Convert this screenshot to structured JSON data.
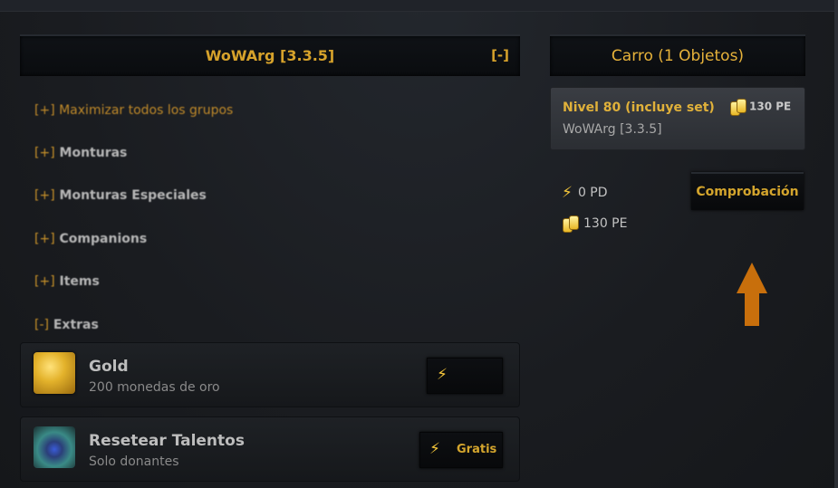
{
  "store": {
    "title": "WoWArg [3.3.5]",
    "collapse_label": "[-]",
    "maximize_label": "[+] Maximizar todos los grupos",
    "groups": [
      {
        "toggle": "[+]",
        "label": "Monturas"
      },
      {
        "toggle": "[+]",
        "label": "Monturas Especiales"
      },
      {
        "toggle": "[+]",
        "label": "Companions"
      },
      {
        "toggle": "[+]",
        "label": "Items"
      },
      {
        "toggle": "[-]",
        "label": "Extras"
      }
    ],
    "products": [
      {
        "name": "Gold",
        "desc": "200 monedas de oro",
        "icon": "gold-ingot-icon",
        "button_label": ""
      },
      {
        "name": "Resetear Talentos",
        "desc": "Solo donantes",
        "icon": "talent-reset-icon",
        "button_label": "Gratis"
      }
    ]
  },
  "cart": {
    "title": "Carro (1 Objetos)",
    "item": {
      "name": "Nivel 80 (incluye set)",
      "realm": "WoWArg [3.3.5]",
      "price": "130 PE"
    },
    "balances": {
      "pd": "0 PD",
      "pe": "130 PE"
    },
    "checkout_label": "Comprobación"
  },
  "colors": {
    "accent_gold": "#d6a22b",
    "arrow": "#c86f0c",
    "background": "#1b1d21"
  }
}
